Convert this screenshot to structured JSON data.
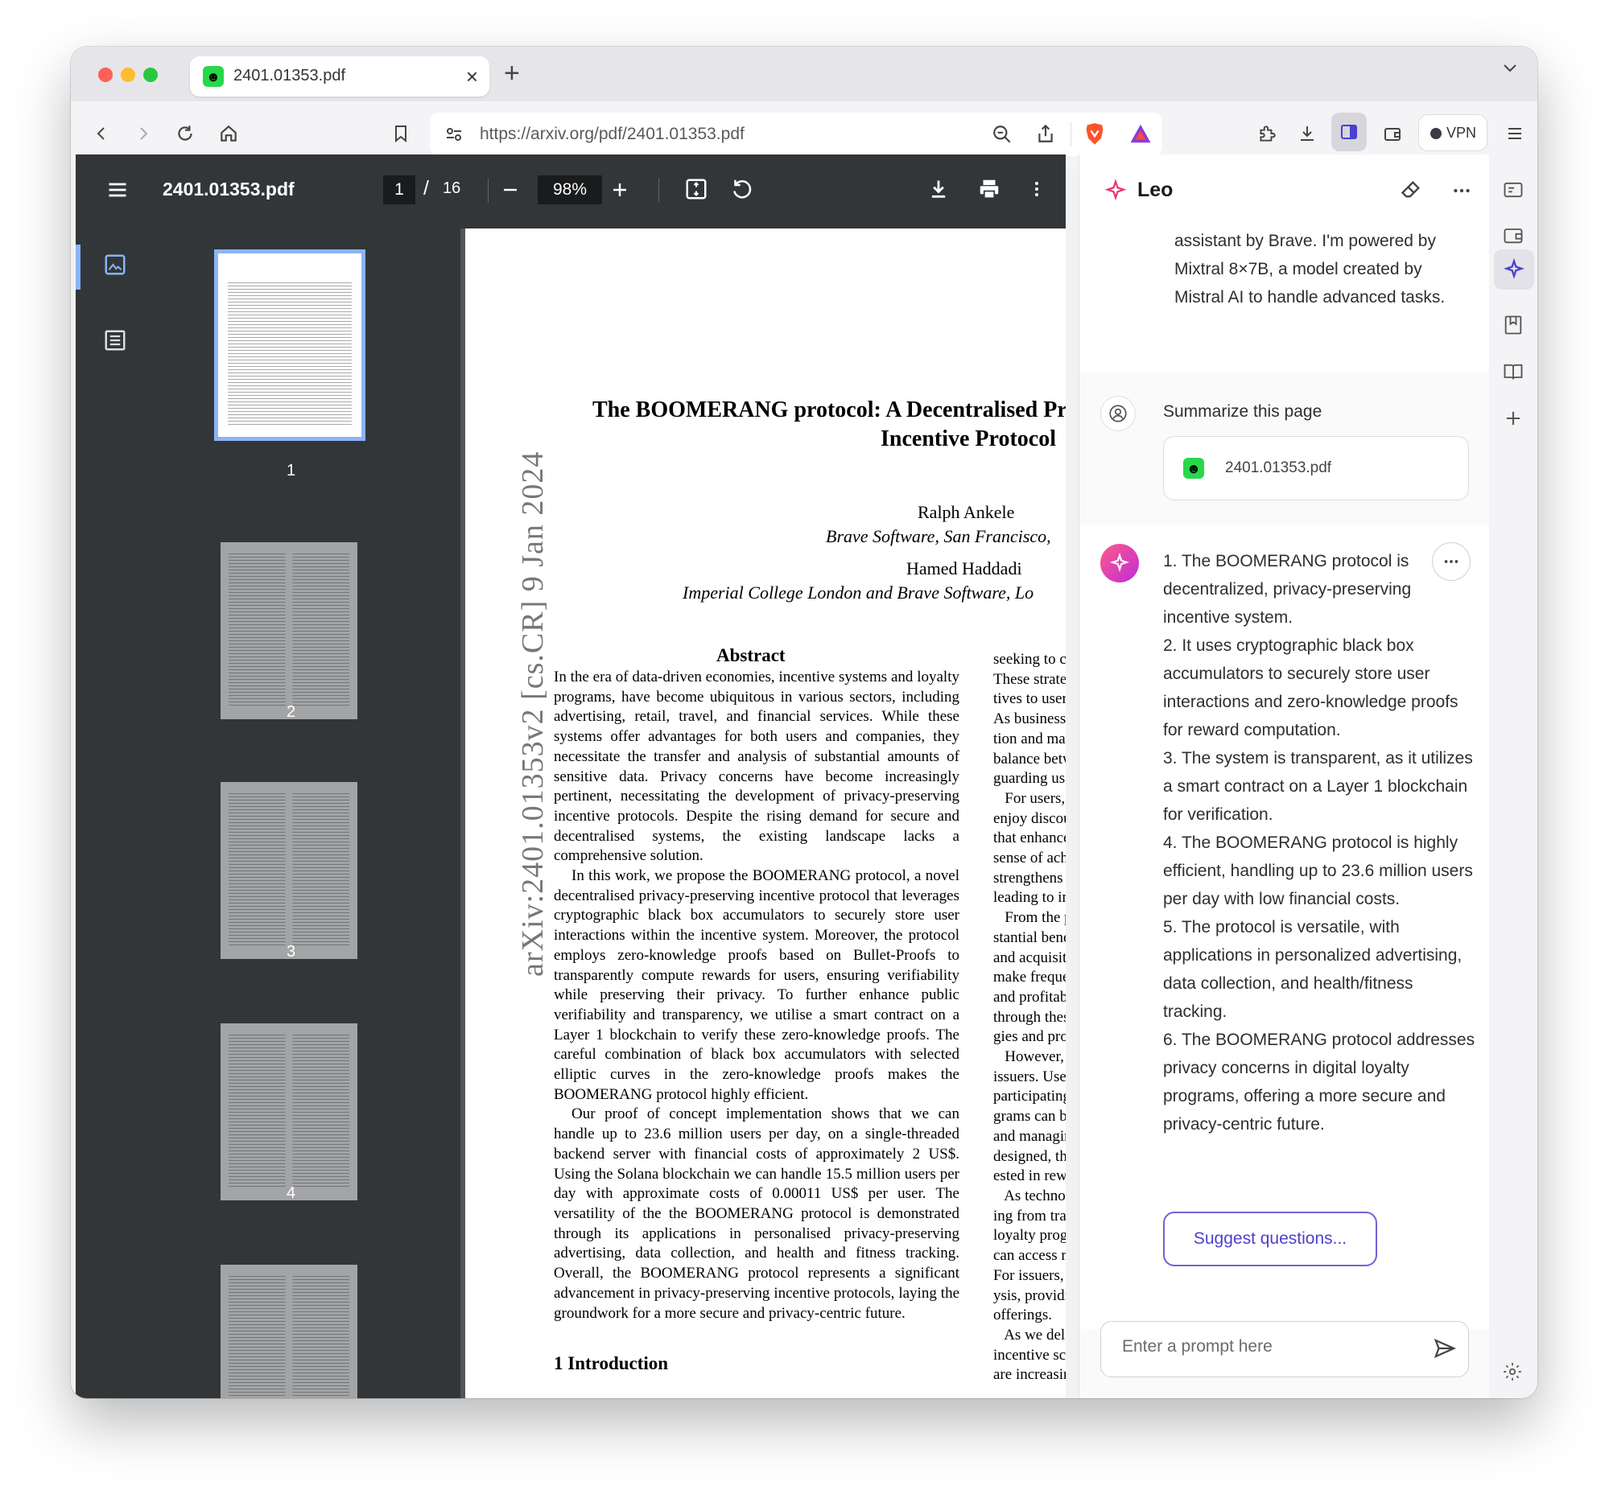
{
  "tab": {
    "title": "2401.01353.pdf",
    "favicon": "smiley-favicon"
  },
  "toolbar": {
    "url": "https://arxiv.org/pdf/2401.01353.pdf",
    "vpn_label": "VPN"
  },
  "pdf": {
    "filename": "2401.01353.pdf",
    "current_page": "1",
    "separator": "/",
    "total_pages": "16",
    "zoom": "98%",
    "thumbnails": [
      "1",
      "2",
      "3",
      "4"
    ]
  },
  "paper": {
    "title_line1": "The BOOMERANG protocol: A Decentralised Pr",
    "title_line2": "Incentive Protocol",
    "author1": "Ralph Ankele",
    "affil1": "Brave Software, San Francisco,",
    "author2": "Hamed Haddadi",
    "affil2": "Imperial College London and Brave Software, Lo",
    "arxiv_stamp": "arXiv:2401.01353v2  [cs.CR]  9 Jan 2024",
    "abstract_heading": "Abstract",
    "abstract_p1": "In the era of data-driven economies, incentive systems and loyalty programs, have become ubiquitous in various sectors, including advertising, retail, travel, and financial services. While these systems offer advantages for both users and companies, they necessitate the transfer and analysis of substantial amounts of sensitive data. Privacy concerns have become increasingly pertinent, necessitating the development of privacy-preserving incentive protocols. Despite the rising demand for secure and decentralised systems, the existing landscape lacks a comprehensive solution.",
    "abstract_p2": "In this work, we propose the BOOMERANG protocol, a novel decentralised privacy-preserving incentive protocol that leverages cryptographic black box accumulators to securely store user interactions within the incentive system. Moreover, the protocol employs zero-knowledge proofs based on Bullet-Proofs to transparently compute rewards for users, ensuring verifiability while preserving their privacy. To further enhance public verifiability and transparency, we utilise a smart contract on a Layer 1 blockchain to verify these zero-knowledge proofs. The careful combination of black box accumulators with selected elliptic curves in the zero-knowledge proofs makes the BOOMERANG protocol highly efficient.",
    "abstract_p3": "Our proof of concept implementation shows that we can handle up to 23.6 million users per day, on a single-threaded backend server with financial costs of approximately 2 US$. Using the Solana blockchain we can handle 15.5 million users per day with approximate costs of 0.00011 US$ per user. The versatility of the the BOOMERANG protocol is demonstrated through its applications in personalised privacy-preserving advertising, data collection, and health and fitness tracking. Overall, the BOOMERANG protocol represents a significant advancement in privacy-preserving incentive protocols, laying the groundwork for a more secure and privacy-centric future.",
    "col2_text": "seeking to c\nThese strateg\ntives to users\nAs businesse\ntion and mar\nbalance betw\nguarding use\n   For users,\nenjoy discou\nthat enhance\nsense of ach\nstrengthens \nleading to in\n   From the p\nstantial bene\nand acquisit\nmake freque\nand profitabi\nthrough thes\ngies and pro\n   However,\nissuers. Use\nparticipating\ngrams can b\nand managir\ndesigned, th\nested in rew\n   As techno\ning from tra\nloyalty progr\ncan access r\nFor issuers, c\nysis, providi\nofferings.\n   As we del\nincentive sch\nare increasir",
    "intro_heading": "1   Introduction"
  },
  "leo": {
    "title": "Leo",
    "intro_text": "assistant by Brave. I'm powered by Mixtral 8×7B, a model created by Mistral AI to handle advanced tasks.",
    "user_query": "Summarize this page",
    "attachment": "2401.01353.pdf",
    "summary": [
      "1. The BOOMERANG protocol is decentralized, privacy-preserving incentive system.",
      "2. It uses cryptographic black box accumulators to securely store user interactions and zero-knowledge proofs for reward computation.",
      "3. The system is transparent, as it utilizes a smart contract on a Layer 1 blockchain for verification.",
      "4. The BOOMERANG protocol is highly efficient, handling up to 23.6 million users per day with low financial costs.",
      "5. The protocol is versatile, with applications in personalized advertising, data collection, and health/fitness tracking.",
      "6. The BOOMERANG protocol addresses privacy concerns in digital loyalty programs, offering a more secure and privacy-centric future."
    ],
    "suggest_label": "Suggest questions...",
    "prompt_placeholder": "Enter a prompt here"
  },
  "colors": {
    "accent": "#6e64d6",
    "pdf_toolbar": "#323639",
    "thumb_highlight": "#8ab4f8"
  }
}
